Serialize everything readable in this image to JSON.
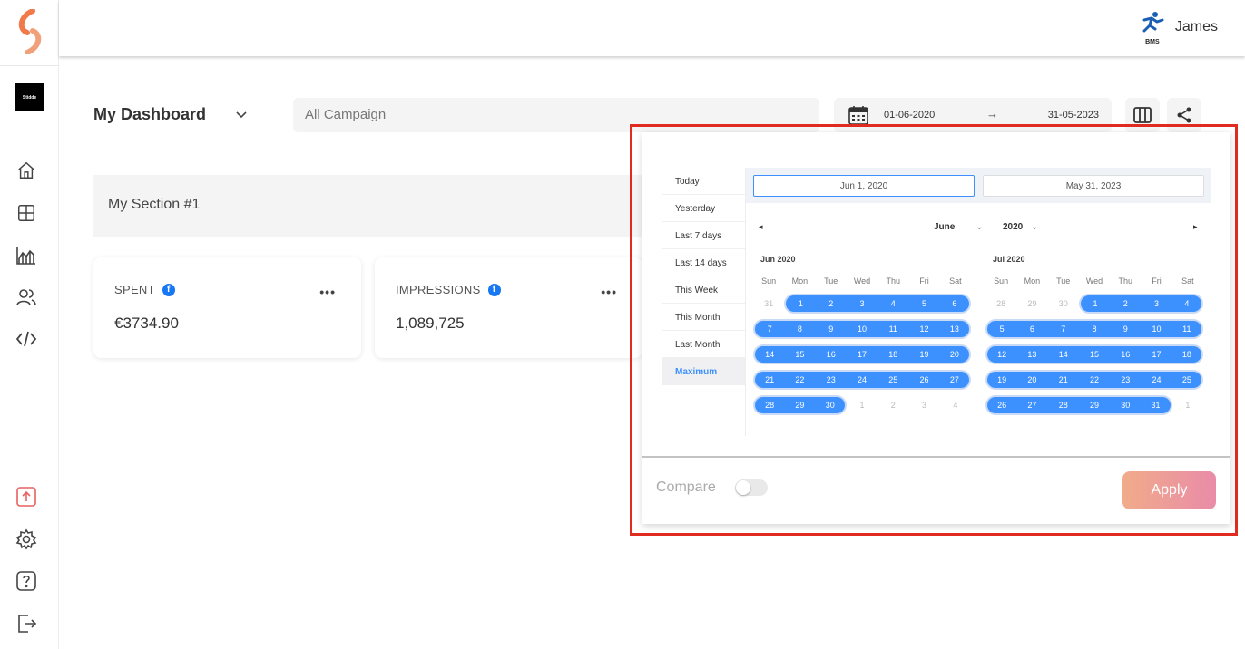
{
  "user": {
    "name": "James",
    "avatar_caption": "BMS"
  },
  "sidebar": {
    "brand_text": "Stidde",
    "items": [
      {
        "name": "home-icon"
      },
      {
        "name": "dashboard-icon"
      },
      {
        "name": "chart-icon"
      },
      {
        "name": "users-icon"
      },
      {
        "name": "code-icon"
      },
      {
        "name": "upload-icon"
      },
      {
        "name": "gear-icon"
      },
      {
        "name": "help-icon"
      },
      {
        "name": "logout-icon"
      }
    ]
  },
  "toolbar": {
    "title": "My Dashboard",
    "campaign_placeholder": "All Campaign",
    "date_from": "01-06-2020",
    "date_arrow": "→",
    "date_to": "31-05-2023"
  },
  "section": {
    "title": "My Section #1"
  },
  "cards": [
    {
      "title": "SPENT",
      "value": "€3734.90",
      "more": "•••"
    },
    {
      "title": "IMPRESSIONS",
      "value": "1,089,725",
      "more": "•••"
    }
  ],
  "picker": {
    "presets": [
      "Today",
      "Yesterday",
      "Last 7 days",
      "Last 14 days",
      "This Week",
      "This Month",
      "Last Month",
      "Maximum"
    ],
    "active_preset": "Maximum",
    "start_input": "Jun 1, 2020",
    "end_input": "May 31, 2023",
    "nav_month": "June",
    "nav_year": "2020",
    "prev_arrow": "◂",
    "next_arrow": "▸",
    "weekdays": [
      "Sun",
      "Mon",
      "Tue",
      "Wed",
      "Thu",
      "Fri",
      "Sat"
    ],
    "months": [
      {
        "title": "Jun 2020",
        "weeks": [
          [
            "31",
            "1",
            "2",
            "3",
            "4",
            "5",
            "6"
          ],
          [
            "7",
            "8",
            "9",
            "10",
            "11",
            "12",
            "13"
          ],
          [
            "14",
            "15",
            "16",
            "17",
            "18",
            "19",
            "20"
          ],
          [
            "21",
            "22",
            "23",
            "24",
            "25",
            "26",
            "27"
          ],
          [
            "28",
            "29",
            "30",
            "1",
            "2",
            "3",
            "4"
          ]
        ],
        "selected": [
          [
            false,
            true,
            true,
            true,
            true,
            true,
            true
          ],
          [
            true,
            true,
            true,
            true,
            true,
            true,
            true
          ],
          [
            true,
            true,
            true,
            true,
            true,
            true,
            true
          ],
          [
            true,
            true,
            true,
            true,
            true,
            true,
            true
          ],
          [
            true,
            true,
            true,
            false,
            false,
            false,
            false
          ]
        ]
      },
      {
        "title": "Jul 2020",
        "weeks": [
          [
            "28",
            "29",
            "30",
            "1",
            "2",
            "3",
            "4"
          ],
          [
            "5",
            "6",
            "7",
            "8",
            "9",
            "10",
            "11"
          ],
          [
            "12",
            "13",
            "14",
            "15",
            "16",
            "17",
            "18"
          ],
          [
            "19",
            "20",
            "21",
            "22",
            "23",
            "24",
            "25"
          ],
          [
            "26",
            "27",
            "28",
            "29",
            "30",
            "31",
            "1"
          ]
        ],
        "selected": [
          [
            false,
            false,
            false,
            true,
            true,
            true,
            true
          ],
          [
            true,
            true,
            true,
            true,
            true,
            true,
            true
          ],
          [
            true,
            true,
            true,
            true,
            true,
            true,
            true
          ],
          [
            true,
            true,
            true,
            true,
            true,
            true,
            true
          ],
          [
            true,
            true,
            true,
            true,
            true,
            true,
            false
          ]
        ]
      }
    ],
    "compare_label": "Compare",
    "apply_label": "Apply"
  }
}
